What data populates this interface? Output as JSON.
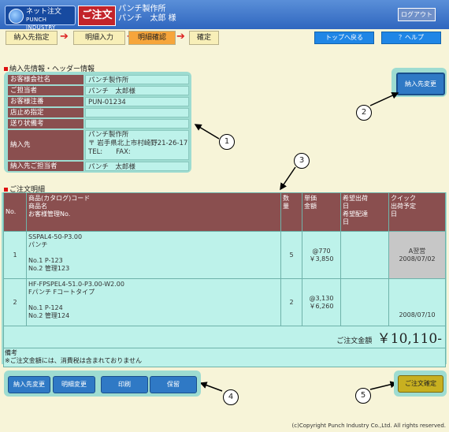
{
  "header": {
    "logo_line1": "ネット注文",
    "logo_line2": "PUNCH INDUSTRY",
    "title": "ご注文",
    "company": "パンチ製作所",
    "user": "パンチ　太郎 様",
    "logout": "ログアウト"
  },
  "steps": [
    "納入先指定",
    "明細入力",
    "明細確認",
    "確定"
  ],
  "nav": {
    "top": "トップへ戻る",
    "help": "？ヘルプ"
  },
  "sections": {
    "info_title": "納入先情報・ヘッダー情報",
    "order_title": "ご注文明細"
  },
  "info": [
    {
      "label": "お客様会社名",
      "value": "パンチ製作所"
    },
    {
      "label": "ご担当者",
      "value": "パンチ　太郎様"
    },
    {
      "label": "お客様注番",
      "value": "PUN-01234"
    },
    {
      "label": "店止め指定",
      "value": ""
    },
    {
      "label": "送り状備考",
      "value": ""
    },
    {
      "label": "納入先",
      "value": "パンチ製作所\n〒 岩手県北上市村崎野21-26-17\nTEL:　　FAX:"
    },
    {
      "label": "納入先ご担当者",
      "value": "パンチ　太郎様"
    }
  ],
  "change_delivery": "納入先変更",
  "callouts": [
    "1",
    "2",
    "3",
    "4",
    "5"
  ],
  "table": {
    "headers": [
      "No.",
      "商品(カタログ)コード\n商品名\nお客様管理No.",
      "数\n量",
      "単価\n金額",
      "希望出荷\n日\n希望配達\n日",
      "クイック\n出荷予定\n日"
    ],
    "rows": [
      {
        "no": "1",
        "code": "SSPAL4-50-P3.00",
        "name": "パンチ",
        "ref1": "No.1 P-123",
        "ref2": "No.2 管理123",
        "qty": "5",
        "price": "@770",
        "amount": "￥3,850",
        "desired": "",
        "quick_status": "A翌営",
        "quick_date": "2008/07/02"
      },
      {
        "no": "2",
        "code": "HF-FPSPEL4-51.0-P3.00-W2.00",
        "name": "Fパンチ Fコートタイプ",
        "ref1": "No.1 P-124",
        "ref2": "No.2 管理124",
        "qty": "2",
        "price": "@3,130",
        "amount": "￥6,260",
        "desired": "",
        "quick_status": "",
        "quick_date": "2008/07/10"
      }
    ],
    "total_label": "ご注文金額",
    "total_value": "￥10,110-",
    "note_label": "備考",
    "note_text": "※ご注文金額には、消費税は含まれておりません"
  },
  "bottom_buttons": [
    "納入先変更",
    "明細変更",
    "印刷",
    "保留"
  ],
  "confirm": "ご注文確定",
  "copyright": "(c)Copyright Punch Industry Co.,Ltd. All rights reserved.",
  "colors": {
    "header": "#2f66bf",
    "label": "#8a4f4f",
    "cell": "#bdf2ea",
    "active_step": "#f6a53b",
    "accent_red": "#c3242a"
  }
}
